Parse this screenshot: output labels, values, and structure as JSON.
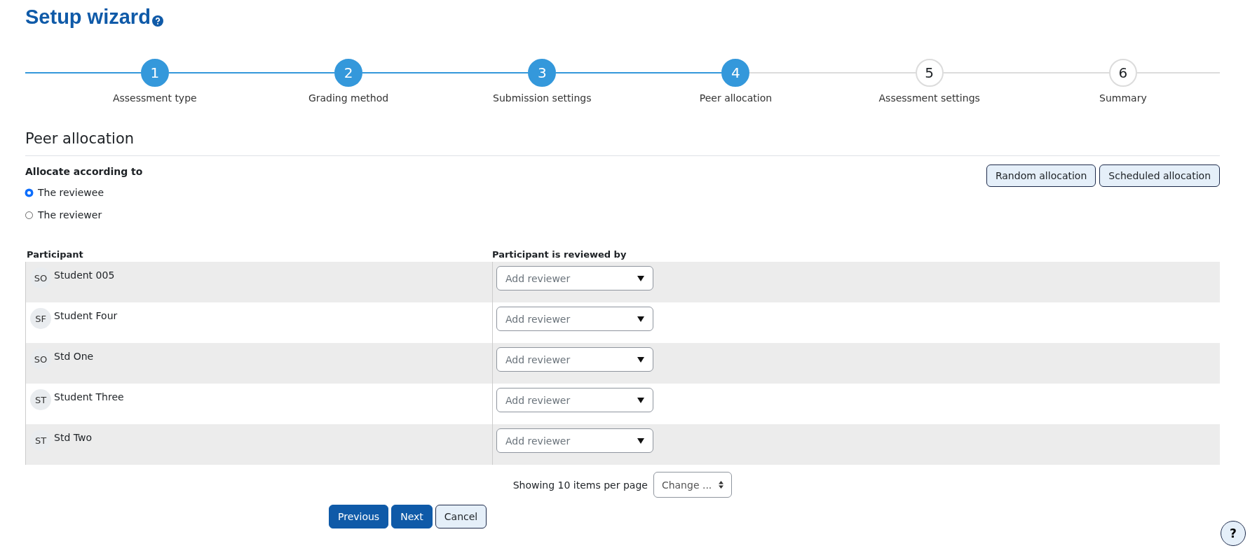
{
  "title": "Setup wizard",
  "steps": [
    {
      "number": "1",
      "label": "Assessment type",
      "active": true
    },
    {
      "number": "2",
      "label": "Grading method",
      "active": true
    },
    {
      "number": "3",
      "label": "Submission settings",
      "active": true
    },
    {
      "number": "4",
      "label": "Peer allocation",
      "active": true
    },
    {
      "number": "5",
      "label": "Assessment settings",
      "active": false
    },
    {
      "number": "6",
      "label": "Summary",
      "active": false
    }
  ],
  "section_title": "Peer allocation",
  "allocate": {
    "label": "Allocate according to",
    "options": [
      {
        "label": "The reviewee",
        "selected": true
      },
      {
        "label": "The reviewer",
        "selected": false
      }
    ]
  },
  "allocation_buttons": [
    "Random allocation",
    "Scheduled allocation"
  ],
  "table": {
    "columns": [
      "Participant",
      "Participant is reviewed by"
    ],
    "rows": [
      {
        "initials": "SO",
        "name": "Student 005",
        "reviewer": {
          "placeholder": "Add reviewer"
        }
      },
      {
        "initials": "SF",
        "name": "Student Four",
        "reviewer": {
          "placeholder": "Add reviewer"
        }
      },
      {
        "initials": "SO",
        "name": "Std One",
        "reviewer": {
          "placeholder": "Add reviewer"
        }
      },
      {
        "initials": "ST",
        "name": "Student Three",
        "reviewer": {
          "placeholder": "Add reviewer"
        }
      },
      {
        "initials": "ST",
        "name": "Std Two",
        "reviewer": {
          "placeholder": "Add reviewer"
        }
      }
    ]
  },
  "pagination": {
    "label": "Showing 10 items per page",
    "select": "Change ..."
  },
  "nav_buttons": [
    {
      "label": "Previous",
      "kind": "primary"
    },
    {
      "label": "Next",
      "kind": "primary"
    },
    {
      "label": "Cancel",
      "kind": "secondary"
    }
  ],
  "help_button": "?"
}
